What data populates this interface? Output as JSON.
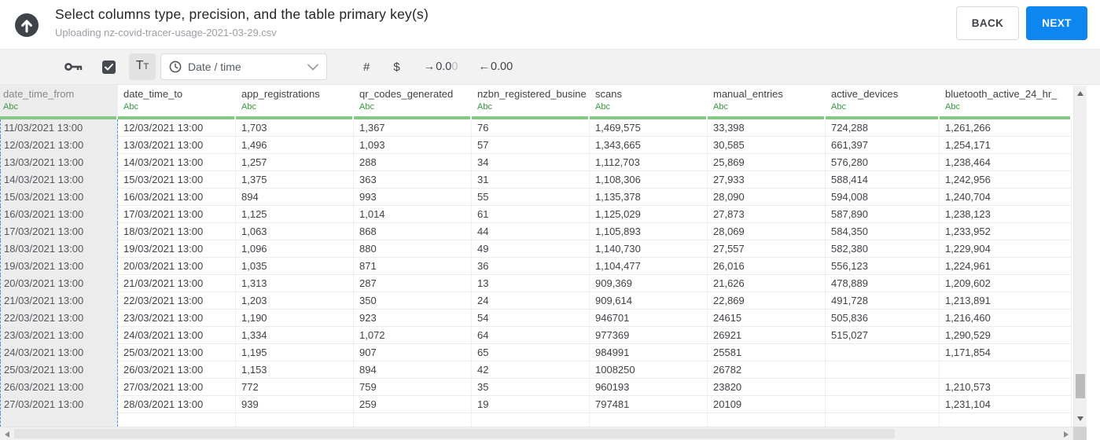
{
  "header": {
    "title": "Select columns type, precision, and the table primary key(s)",
    "subtitle": "Uploading nz-covid-tracer-usage-2021-03-29.csv",
    "back_label": "BACK",
    "next_label": "NEXT"
  },
  "toolbar": {
    "primary_key_icon": "key",
    "checkbox_checked": true,
    "text_type_large": "T",
    "text_type_small": "T",
    "type_dropdown_value": "Date / time",
    "number_label": "#",
    "currency_label": "$",
    "precision_add": {
      "arrow": "→",
      "digits": "0.0",
      "faded_digit": "0"
    },
    "precision_remove": {
      "arrow": "←",
      "digits": "0.00"
    }
  },
  "table": {
    "type_label": "Abc",
    "selected_column": "date_time_from",
    "columns": [
      "date_time_from",
      "date_time_to",
      "app_registrations",
      "qr_codes_generated",
      "nzbn_registered_busine",
      "scans",
      "manual_entries",
      "active_devices",
      "bluetooth_active_24_hr_"
    ],
    "rows": [
      [
        "11/03/2021 13:00",
        "12/03/2021 13:00",
        "1,703",
        "1,367",
        "76",
        "1,469,575",
        "33,398",
        "724,288",
        "1,261,266"
      ],
      [
        "12/03/2021 13:00",
        "13/03/2021 13:00",
        "1,496",
        "1,093",
        "57",
        "1,343,665",
        "30,585",
        "661,397",
        "1,254,171"
      ],
      [
        "13/03/2021 13:00",
        "14/03/2021 13:00",
        "1,257",
        "288",
        "34",
        "1,112,703",
        "25,869",
        "576,280",
        "1,238,464"
      ],
      [
        "14/03/2021 13:00",
        "15/03/2021 13:00",
        "1,375",
        "363",
        "31",
        "1,108,306",
        "27,933",
        "588,414",
        "1,242,956"
      ],
      [
        "15/03/2021 13:00",
        "16/03/2021 13:00",
        "894",
        "993",
        "55",
        "1,135,378",
        "28,090",
        "594,008",
        "1,240,704"
      ],
      [
        "16/03/2021 13:00",
        "17/03/2021 13:00",
        "1,125",
        "1,014",
        "61",
        "1,125,029",
        "27,873",
        "587,890",
        "1,238,123"
      ],
      [
        "17/03/2021 13:00",
        "18/03/2021 13:00",
        "1,063",
        "868",
        "44",
        "1,105,893",
        "28,069",
        "584,350",
        "1,233,952"
      ],
      [
        "18/03/2021 13:00",
        "19/03/2021 13:00",
        "1,096",
        "880",
        "49",
        "1,140,730",
        "27,557",
        "582,380",
        "1,229,904"
      ],
      [
        "19/03/2021 13:00",
        "20/03/2021 13:00",
        "1,035",
        "871",
        "36",
        "1,104,477",
        "26,016",
        "556,123",
        "1,224,961"
      ],
      [
        "20/03/2021 13:00",
        "21/03/2021 13:00",
        "1,313",
        "287",
        "13",
        "909,369",
        "21,626",
        "478,889",
        "1,209,602"
      ],
      [
        "21/03/2021 13:00",
        "22/03/2021 13:00",
        "1,203",
        "350",
        "24",
        "909,614",
        "22,869",
        "491,728",
        "1,213,891"
      ],
      [
        "22/03/2021 13:00",
        "23/03/2021 13:00",
        "1,190",
        "923",
        "54",
        "946701",
        "24615",
        "505,836",
        "1,216,460"
      ],
      [
        "23/03/2021 13:00",
        "24/03/2021 13:00",
        "1,334",
        "1,072",
        "64",
        "977369",
        "26921",
        "515,027",
        "1,290,529"
      ],
      [
        "24/03/2021 13:00",
        "25/03/2021 13:00",
        "1,195",
        "907",
        "65",
        "984991",
        "25581",
        "",
        "1,171,854"
      ],
      [
        "25/03/2021 13:00",
        "26/03/2021 13:00",
        "1,153",
        "894",
        "42",
        "1008250",
        "26782",
        "",
        ""
      ],
      [
        "26/03/2021 13:00",
        "27/03/2021 13:00",
        "772",
        "759",
        "35",
        "960193",
        "23820",
        "",
        "1,210,573"
      ],
      [
        "27/03/2021 13:00",
        "28/03/2021 13:00",
        "939",
        "259",
        "19",
        "797481",
        "20109",
        "",
        "1,231,104"
      ]
    ]
  },
  "colors": {
    "accent_blue": "#0e86f1",
    "type_green": "#359a3e",
    "header_underline_green": "#85c985",
    "selection_dash_blue": "#4f93e0",
    "selected_column_bg": "#ececec",
    "toolbar_bg": "#f2f2f3"
  }
}
